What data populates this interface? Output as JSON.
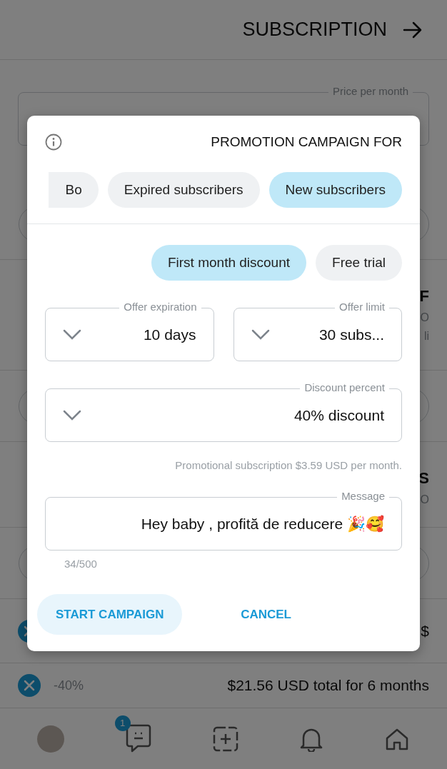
{
  "header": {
    "title": "SUBSCRIPTION"
  },
  "price_field": {
    "label": "Price per month"
  },
  "background_rows": [
    {
      "kind": "pill"
    },
    {
      "kind": "text",
      "title": "F",
      "lines": [
        "O",
        "li"
      ]
    },
    {
      "kind": "pill"
    },
    {
      "kind": "text",
      "title": "S",
      "lines": [
        "O"
      ]
    },
    {
      "kind": "pill"
    },
    {
      "kind": "bundle",
      "text": "$"
    },
    {
      "kind": "bundle",
      "text": "$21.56 USD total for 6 months",
      "discount": "-40%"
    }
  ],
  "bottom_nav": {
    "messages_badge": "1"
  },
  "dialog": {
    "title": "PROMOTION CAMPAIGN FOR",
    "audience": [
      {
        "label": "Bo",
        "selected": false
      },
      {
        "label": "Expired subscribers",
        "selected": false
      },
      {
        "label": "New subscribers",
        "selected": true
      }
    ],
    "offer_types": [
      {
        "label": "First month discount",
        "selected": true
      },
      {
        "label": "Free trial",
        "selected": false
      }
    ],
    "fields_row": [
      {
        "label": "Offer expiration",
        "value": "10 days"
      },
      {
        "label": "Offer limit",
        "value": "30 subs..."
      }
    ],
    "discount": {
      "label": "Discount percent",
      "value": "40% discount"
    },
    "helper": "Promotional subscription $3.59 USD per month.",
    "message": {
      "label": "Message",
      "value": "Hey baby , profită de reducere 🎉🥰",
      "counter": "34/500"
    },
    "cancel": "CANCEL",
    "start": "START CAMPAIGN"
  }
}
